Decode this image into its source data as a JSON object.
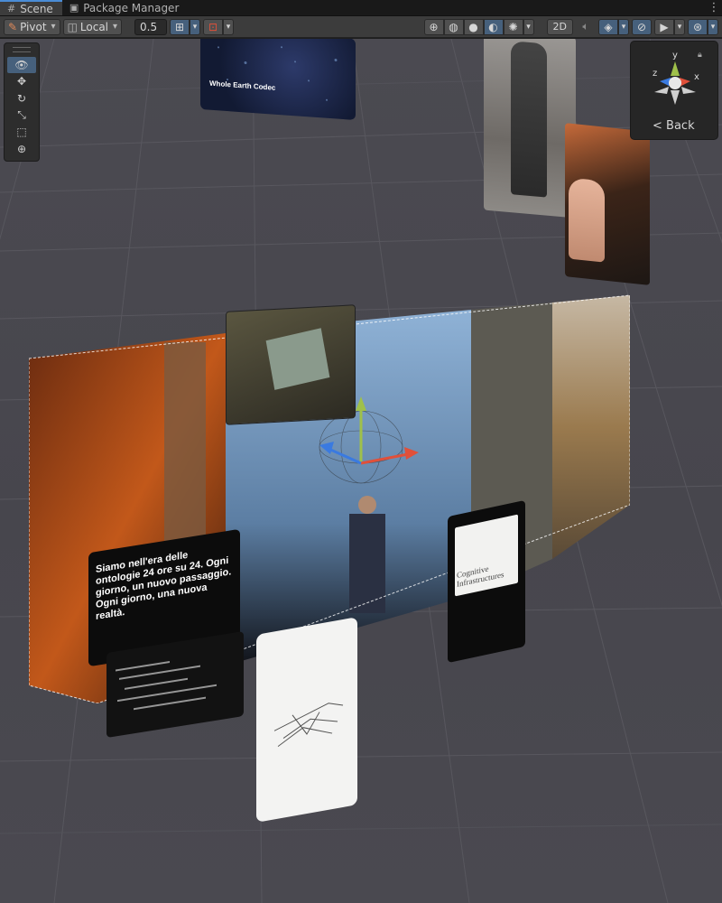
{
  "tabs": [
    {
      "label": "Scene",
      "icon": "grid-icon",
      "active": true
    },
    {
      "label": "Package Manager",
      "icon": "package-icon",
      "active": false
    }
  ],
  "toolbar": {
    "pivot_label": "Pivot",
    "space_label": "Local",
    "snap_value": "0.5",
    "mode_2d_label": "2D"
  },
  "gizmo": {
    "back_label": "Back",
    "axis_y": "y",
    "axis_x": "x",
    "axis_z": "z",
    "colors": {
      "x": "#e0503a",
      "y": "#9fc04a",
      "z": "#3a7ae0"
    }
  },
  "scene_text": {
    "codec_title": "Whole Earth Codec",
    "quote": "Siamo nell'era delle ontologie 24 ore su 24. Ogni giorno, un nuovo passaggio. Ogni giorno, una nuova realtà.",
    "cognitive": "Cognitive Infrastructures"
  },
  "colors": {
    "accent": "#4a8cd6",
    "selection": "#46607c",
    "gizmo_x": "#e0503a",
    "gizmo_y": "#9fc04a",
    "gizmo_z": "#3a7ae0"
  }
}
